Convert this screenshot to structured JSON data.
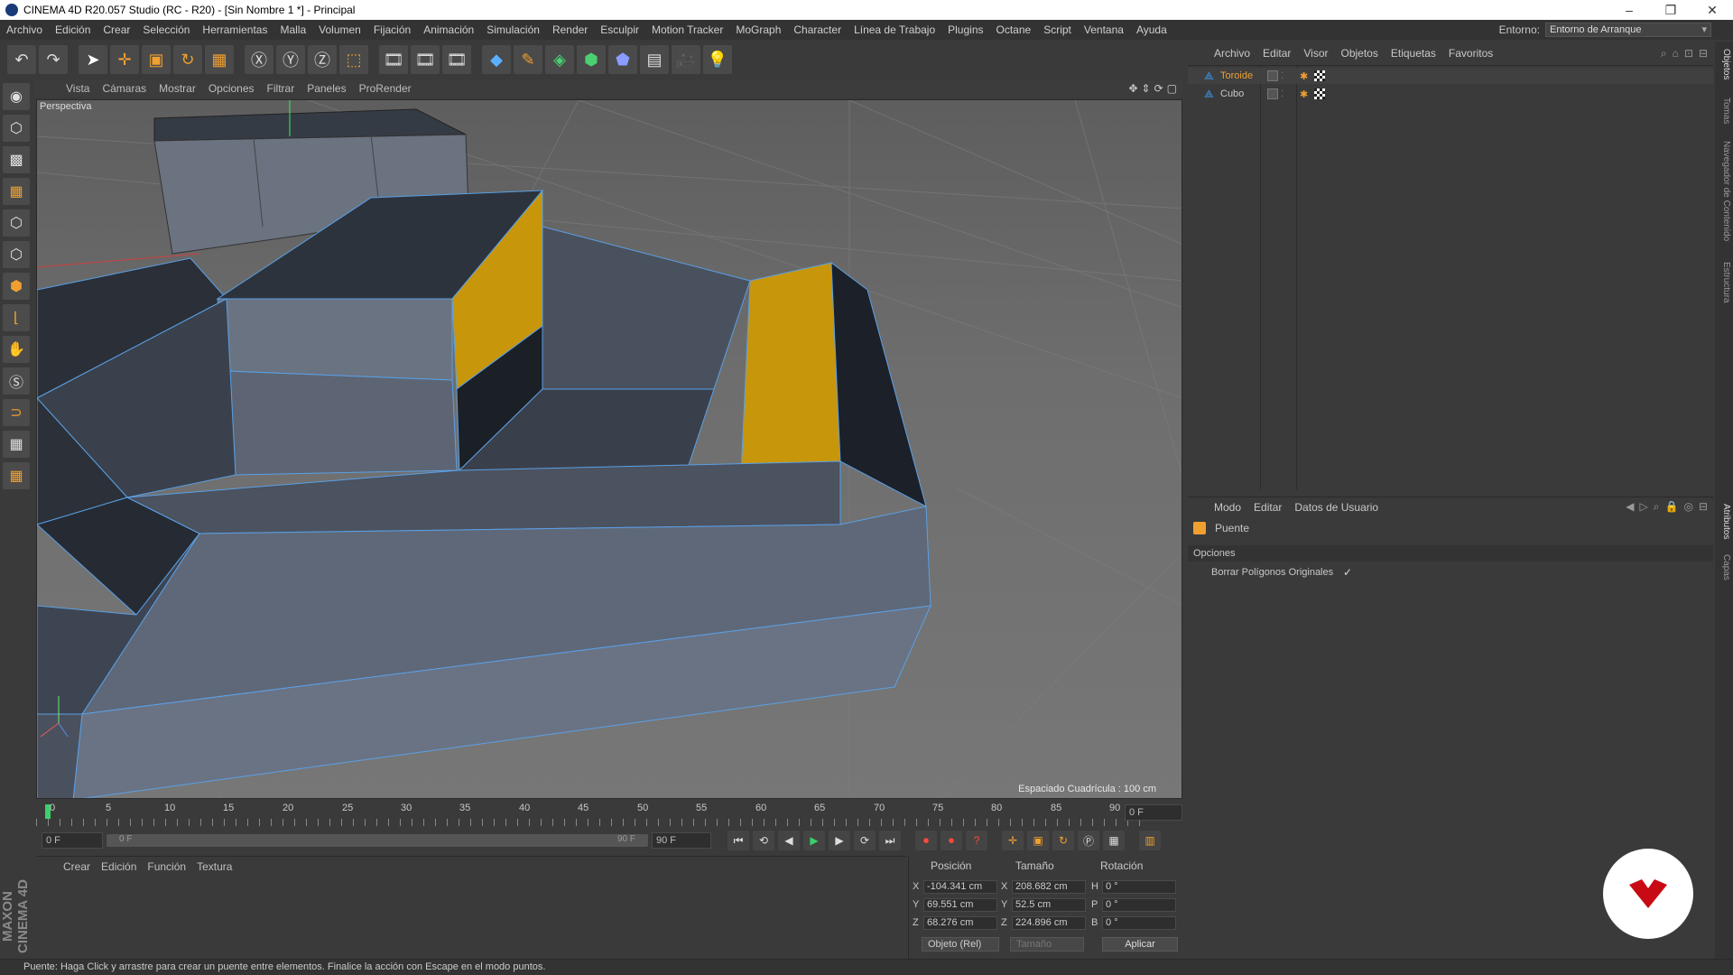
{
  "window": {
    "title": "CINEMA 4D R20.057 Studio (RC - R20) - [Sin Nombre 1 *] - Principal",
    "controls": [
      "–",
      "❐",
      "✕"
    ]
  },
  "menubar": {
    "items": [
      "Archivo",
      "Edición",
      "Crear",
      "Selección",
      "Herramientas",
      "Malla",
      "Volumen",
      "Fijación",
      "Animación",
      "Simulación",
      "Render",
      "Esculpir",
      "Motion Tracker",
      "MoGraph",
      "Character",
      "Línea de Trabajo",
      "Plugins",
      "Octane",
      "Script",
      "Ventana",
      "Ayuda"
    ],
    "env_label": "Entorno:",
    "env_value": "Entorno de Arranque"
  },
  "viewport": {
    "menu": [
      "Vista",
      "Cámaras",
      "Mostrar",
      "Opciones",
      "Filtrar",
      "Paneles",
      "ProRender"
    ],
    "label": "Perspectiva",
    "grid_spacing": "Espaciado Cuadrícula : 100 cm"
  },
  "timeline": {
    "ticks": [
      "0",
      "5",
      "10",
      "15",
      "20",
      "25",
      "30",
      "35",
      "40",
      "45",
      "50",
      "55",
      "60",
      "65",
      "70",
      "75",
      "80",
      "85",
      "90"
    ],
    "current_frame": "0 F",
    "start": "0 F",
    "slider_start": "0 F",
    "slider_end": "90 F",
    "end": "90 F"
  },
  "material_menu": [
    "Crear",
    "Edición",
    "Función",
    "Textura"
  ],
  "brand": "MAXON CINEMA 4D",
  "coords": {
    "headers": [
      "Posición",
      "Tamaño",
      "Rotación"
    ],
    "rows": [
      {
        "axis": "X",
        "pos": "-104.341 cm",
        "size_axis": "X",
        "size": "208.682 cm",
        "rot_axis": "H",
        "rot": "0 °"
      },
      {
        "axis": "Y",
        "pos": "69.551 cm",
        "size_axis": "Y",
        "size": "52.5 cm",
        "rot_axis": "P",
        "rot": "0 °"
      },
      {
        "axis": "Z",
        "pos": "68.276 cm",
        "size_axis": "Z",
        "size": "224.896 cm",
        "rot_axis": "B",
        "rot": "0 °"
      }
    ],
    "mode": "Objeto (Rel)",
    "size_mode": "Tamaño",
    "apply": "Aplicar"
  },
  "objects": {
    "menu": [
      "Archivo",
      "Editar",
      "Visor",
      "Objetos",
      "Etiquetas",
      "Favoritos"
    ],
    "items": [
      {
        "name": "Toroide",
        "color": "#f0a030"
      },
      {
        "name": "Cubo",
        "color": "#c8c8c8"
      }
    ]
  },
  "attributes": {
    "menu": [
      "Modo",
      "Editar",
      "Datos de Usuario"
    ],
    "tool_name": "Puente",
    "section": "Opciones",
    "option_label": "Borrar Polígonos Originales",
    "option_value": "✓"
  },
  "side_tabs": [
    "Objetos",
    "Tomas",
    "Navegador de Contenido",
    "Estructura",
    "Atributos",
    "Capas"
  ],
  "status": "Puente: Haga Click y arrastre para crear un puente entre elementos. Finalice la acción con Escape en el modo puntos."
}
